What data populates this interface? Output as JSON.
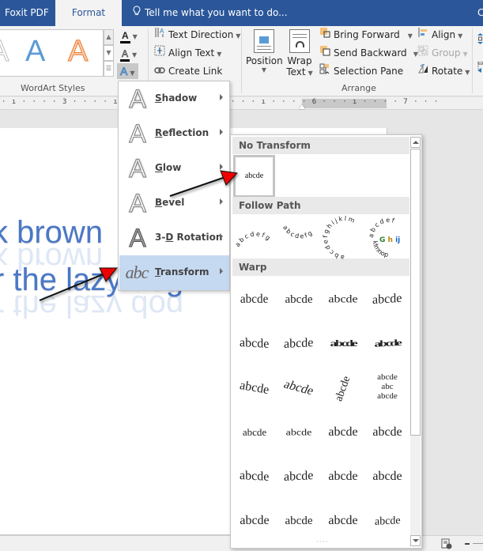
{
  "tabs": {
    "foxit": "Foxit PDF",
    "format": "Format",
    "tell_me": "Tell me what you want to do...",
    "right_cut": "C"
  },
  "ribbon": {
    "wordart_styles": {
      "label": "WordArt Styles",
      "gallery": [
        {
          "glyph": "A",
          "color": "#5b9bd5"
        },
        {
          "glyph": "A",
          "color": "#f4b183"
        }
      ],
      "text_fill_glyph": "A",
      "text_outline_glyph": "A",
      "text_effects_glyph": "A"
    },
    "text": {
      "text_direction": "Text Direction",
      "align_text": "Align Text",
      "create_link": "Create Link"
    },
    "arrange": {
      "label": "Arrange",
      "position": "Position",
      "wrap_text_line1": "Wrap",
      "wrap_text_line2": "Text",
      "bring_forward": "Bring Forward",
      "send_backward": "Send Backward",
      "selection_pane": "Selection Pane",
      "align": "Align",
      "group": "Group",
      "rotate": "Rotate"
    }
  },
  "ruler": {
    "mark_3": "3",
    "mark_6": "6",
    "mark_7": "7"
  },
  "document": {
    "line1": "k brown",
    "line2": "r the lazy dog"
  },
  "text_effects_menu": {
    "items": [
      {
        "label": "Shadow",
        "accel": "S",
        "rest": "hadow"
      },
      {
        "label": "Reflection",
        "accel": "R",
        "rest": "eflection"
      },
      {
        "label": "Glow",
        "accel": "G",
        "rest": "low"
      },
      {
        "label": "Bevel",
        "accel": "B",
        "rest": "evel"
      },
      {
        "label": "3-D Rotation",
        "pre": "3-",
        "accel": "D",
        "rest": " Rotation"
      },
      {
        "label": "Transform",
        "accel": "T",
        "rest": "ransform",
        "selected": true,
        "icon_text": "abc"
      }
    ]
  },
  "transform_submenu": {
    "sections": {
      "no_transform": "No Transform",
      "follow_path": "Follow Path",
      "warp": "Warp"
    },
    "no_transform_sample": "abcde",
    "follow_path_samples": [
      "abcdefg arch up",
      "abcdefg arch down",
      "abcdefghijklm circle",
      "abcdef Ghij klmnop button"
    ],
    "warp_sample": "abcde",
    "warp_extra": {
      "circle_text": "abcde",
      "button_mid": "abc"
    }
  }
}
